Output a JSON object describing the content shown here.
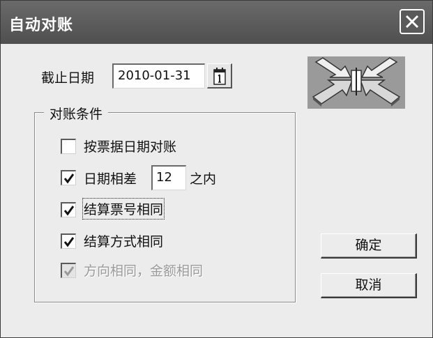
{
  "window": {
    "title": "自动对账"
  },
  "date": {
    "label": "截止日期",
    "value": "2010-01-31"
  },
  "group": {
    "title": "对账条件",
    "options": [
      {
        "label": "按票据日期对账",
        "checked": false,
        "enabled": true
      },
      {
        "label_before": "日期相差",
        "days": "12",
        "label_after": "之内",
        "checked": true,
        "enabled": true
      },
      {
        "label": "结算票号相同",
        "checked": true,
        "enabled": true
      },
      {
        "label": "结算方式相同",
        "checked": true,
        "enabled": true
      },
      {
        "label": "方向相同，金额相同",
        "checked": true,
        "enabled": false
      }
    ]
  },
  "buttons": {
    "ok": "确定",
    "cancel": "取消"
  },
  "icons": {
    "close": "close-icon",
    "calendar": "calendar-icon",
    "logo": "converging-arrows-icon",
    "check": "checkmark-icon"
  }
}
